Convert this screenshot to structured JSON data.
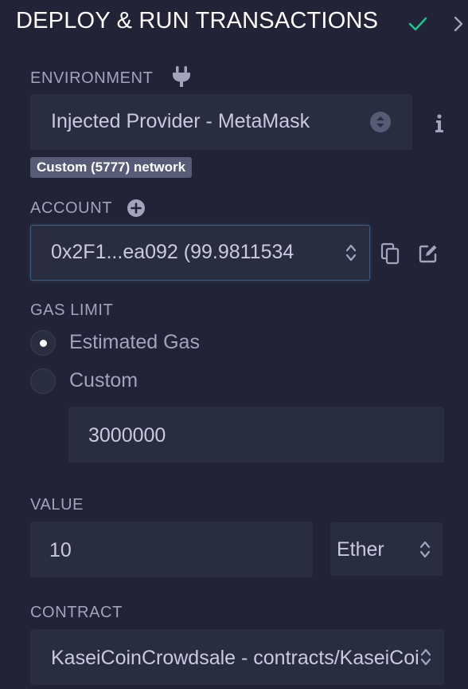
{
  "header": {
    "title": "DEPLOY & RUN TRANSACTIONS",
    "check_icon": "check-icon",
    "chevron_icon": "chevron-right-icon"
  },
  "environment": {
    "label": "ENVIRONMENT",
    "label_icon": "plug-icon",
    "selected": "Injected Provider - MetaMask",
    "info_icon": "info-icon",
    "network_badge": "Custom (5777) network"
  },
  "account": {
    "label": "ACCOUNT",
    "add_icon": "plus-circle-icon",
    "selected": "0x2F1...ea092 (99.9811534",
    "copy_icon": "copy-icon",
    "edit_icon": "edit-icon"
  },
  "gas_limit": {
    "label": "GAS LIMIT",
    "options": [
      {
        "label": "Estimated Gas",
        "checked": true
      },
      {
        "label": "Custom",
        "checked": false
      }
    ],
    "custom_value": "3000000"
  },
  "value": {
    "label": "VALUE",
    "amount": "10",
    "unit": "Ether"
  },
  "contract": {
    "label": "CONTRACT",
    "selected": "KaseiCoinCrowdsale - contracts/KaseiCoinCrowdsale.sol"
  },
  "colors": {
    "background": "#222336",
    "field": "#2a2c3f",
    "accent_check": "#1ec38a",
    "focus_border": "#3e5b80",
    "badge": "#585b76"
  }
}
